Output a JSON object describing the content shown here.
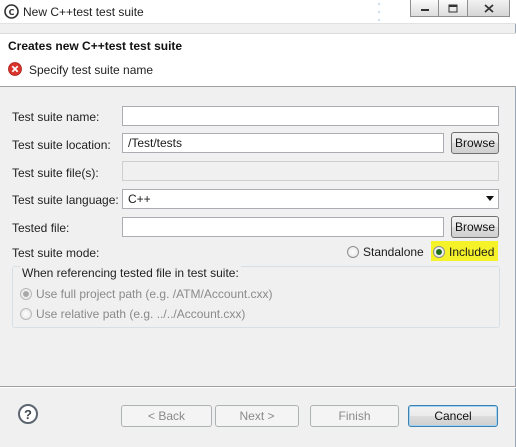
{
  "window": {
    "title": "New C++test test suite",
    "icons": [
      "app-icon",
      "minimize-icon",
      "maximize-icon",
      "close-icon"
    ]
  },
  "banner": {
    "title": "Creates new C++test test suite",
    "message": "Specify test suite name",
    "icon": "error-icon"
  },
  "form": {
    "name": {
      "label": "Test suite name:",
      "value": ""
    },
    "location": {
      "label": "Test suite location:",
      "value": "/Test/tests",
      "browse": "Browse"
    },
    "files": {
      "label": "Test suite file(s):",
      "value": ""
    },
    "language": {
      "label": "Test suite language:",
      "value": "C++"
    },
    "tested_file": {
      "label": "Tested file:",
      "value": "",
      "browse": "Browse"
    },
    "mode": {
      "label": "Test suite mode:",
      "options": [
        "Standalone",
        "Included"
      ],
      "selected": "Included"
    }
  },
  "referencing": {
    "label": "When referencing tested file in test suite:",
    "options": [
      "Use full project path (e.g. /ATM/Account.cxx)",
      "Use relative path (e.g. ../../Account.cxx)"
    ],
    "selected_index": 0
  },
  "footer": {
    "help": "?",
    "back": "< Back",
    "next": "Next >",
    "finish": "Finish",
    "cancel": "Cancel"
  },
  "colors": {
    "highlight": "#f6f22a",
    "error": "#d9342b",
    "selected_radio": "#1f6b1f"
  }
}
